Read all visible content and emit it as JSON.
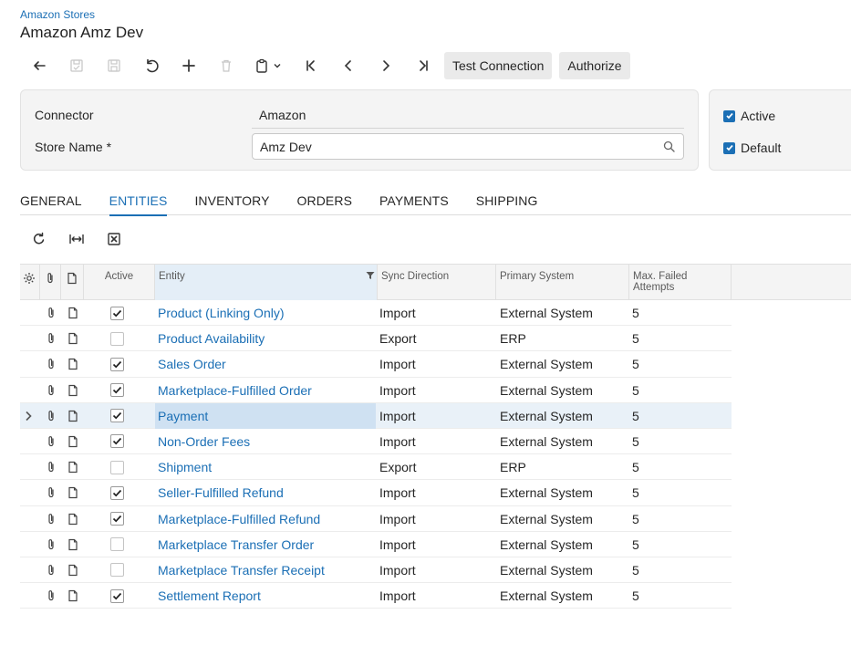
{
  "breadcrumb": "Amazon Stores",
  "title": "Amazon Amz Dev",
  "toolbar": {
    "test_connection": "Test Connection",
    "authorize": "Authorize"
  },
  "form": {
    "connector_label": "Connector",
    "connector_value": "Amazon",
    "store_name_label": "Store Name *",
    "store_name_value": "Amz Dev",
    "active_label": "Active",
    "default_label": "Default",
    "active_checked": true,
    "default_checked": true
  },
  "tabs": [
    "GENERAL",
    "ENTITIES",
    "INVENTORY",
    "ORDERS",
    "PAYMENTS",
    "SHIPPING"
  ],
  "active_tab": "ENTITIES",
  "grid": {
    "columns": {
      "active": "Active",
      "entity": "Entity",
      "sync_direction": "Sync Direction",
      "primary_system": "Primary System",
      "max_failed_line1": "Max. Failed",
      "max_failed_line2": "Attempts"
    },
    "rows": [
      {
        "active": true,
        "entity": "Product (Linking Only)",
        "sync": "Import",
        "primary": "External System",
        "max": "5"
      },
      {
        "active": false,
        "entity": "Product Availability",
        "sync": "Export",
        "primary": "ERP",
        "max": "5"
      },
      {
        "active": true,
        "entity": "Sales Order",
        "sync": "Import",
        "primary": "External System",
        "max": "5"
      },
      {
        "active": true,
        "entity": "Marketplace-Fulfilled Order",
        "sync": "Import",
        "primary": "External System",
        "max": "5"
      },
      {
        "active": true,
        "entity": "Payment",
        "sync": "Import",
        "primary": "External System",
        "max": "5",
        "selected": true
      },
      {
        "active": true,
        "entity": "Non-Order Fees",
        "sync": "Import",
        "primary": "External System",
        "max": "5"
      },
      {
        "active": false,
        "entity": "Shipment",
        "sync": "Export",
        "primary": "ERP",
        "max": "5"
      },
      {
        "active": true,
        "entity": "Seller-Fulfilled Refund",
        "sync": "Import",
        "primary": "External System",
        "max": "5"
      },
      {
        "active": true,
        "entity": "Marketplace-Fulfilled Refund",
        "sync": "Import",
        "primary": "External System",
        "max": "5"
      },
      {
        "active": false,
        "entity": "Marketplace Transfer Order",
        "sync": "Import",
        "primary": "External System",
        "max": "5"
      },
      {
        "active": false,
        "entity": "Marketplace Transfer Receipt",
        "sync": "Import",
        "primary": "External System",
        "max": "5"
      },
      {
        "active": true,
        "entity": "Settlement Report",
        "sync": "Import",
        "primary": "External System",
        "max": "5"
      }
    ]
  },
  "colors": {
    "accent": "#1b6fb5",
    "panel": "#f4f4f4",
    "selected_row": "#e9f1f8"
  }
}
